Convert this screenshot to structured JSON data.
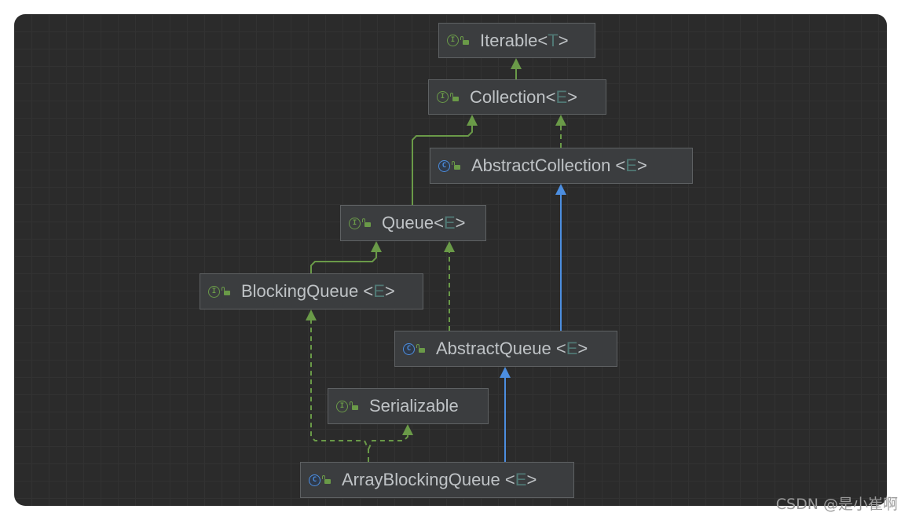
{
  "diagram": {
    "nodes": [
      {
        "id": "iterable",
        "kind": "interface",
        "badge": "I",
        "name": "Iterable",
        "tparam": "T"
      },
      {
        "id": "collection",
        "kind": "interface",
        "badge": "I",
        "name": "Collection",
        "tparam": "E"
      },
      {
        "id": "abstract-collection",
        "kind": "class",
        "badge": "C",
        "name": "AbstractCollection ",
        "tparam": "E"
      },
      {
        "id": "queue",
        "kind": "interface",
        "badge": "I",
        "name": "Queue",
        "tparam": "E"
      },
      {
        "id": "blocking-queue",
        "kind": "interface",
        "badge": "I",
        "name": "BlockingQueue ",
        "tparam": "E"
      },
      {
        "id": "abstract-queue",
        "kind": "class",
        "badge": "C",
        "name": "AbstractQueue ",
        "tparam": "E"
      },
      {
        "id": "serializable",
        "kind": "interface",
        "badge": "I",
        "name": "Serializable",
        "tparam": ""
      },
      {
        "id": "array-blocking-queue",
        "kind": "class",
        "badge": "C",
        "name": "ArrayBlockingQueue ",
        "tparam": "E"
      }
    ],
    "edges": [
      {
        "from": "collection",
        "to": "iterable",
        "relation": "extends"
      },
      {
        "from": "queue",
        "to": "collection",
        "relation": "extends"
      },
      {
        "from": "abstract-collection",
        "to": "collection",
        "relation": "implements"
      },
      {
        "from": "blocking-queue",
        "to": "queue",
        "relation": "extends"
      },
      {
        "from": "abstract-queue",
        "to": "queue",
        "relation": "implements"
      },
      {
        "from": "abstract-queue",
        "to": "abstract-collection",
        "relation": "extends"
      },
      {
        "from": "array-blocking-queue",
        "to": "abstract-queue",
        "relation": "extends"
      },
      {
        "from": "array-blocking-queue",
        "to": "blocking-queue",
        "relation": "implements"
      },
      {
        "from": "array-blocking-queue",
        "to": "serializable",
        "relation": "implements"
      }
    ],
    "colors": {
      "interface_edge": "#6a9a48",
      "class_edge": "#4c8ee0",
      "background": "#2b2b2b",
      "node_fill": "#3b3d3f",
      "node_border": "#5e6163",
      "text": "#bfc3c6",
      "type_param": "#507874"
    }
  },
  "watermark": "CSDN @是小崔啊"
}
